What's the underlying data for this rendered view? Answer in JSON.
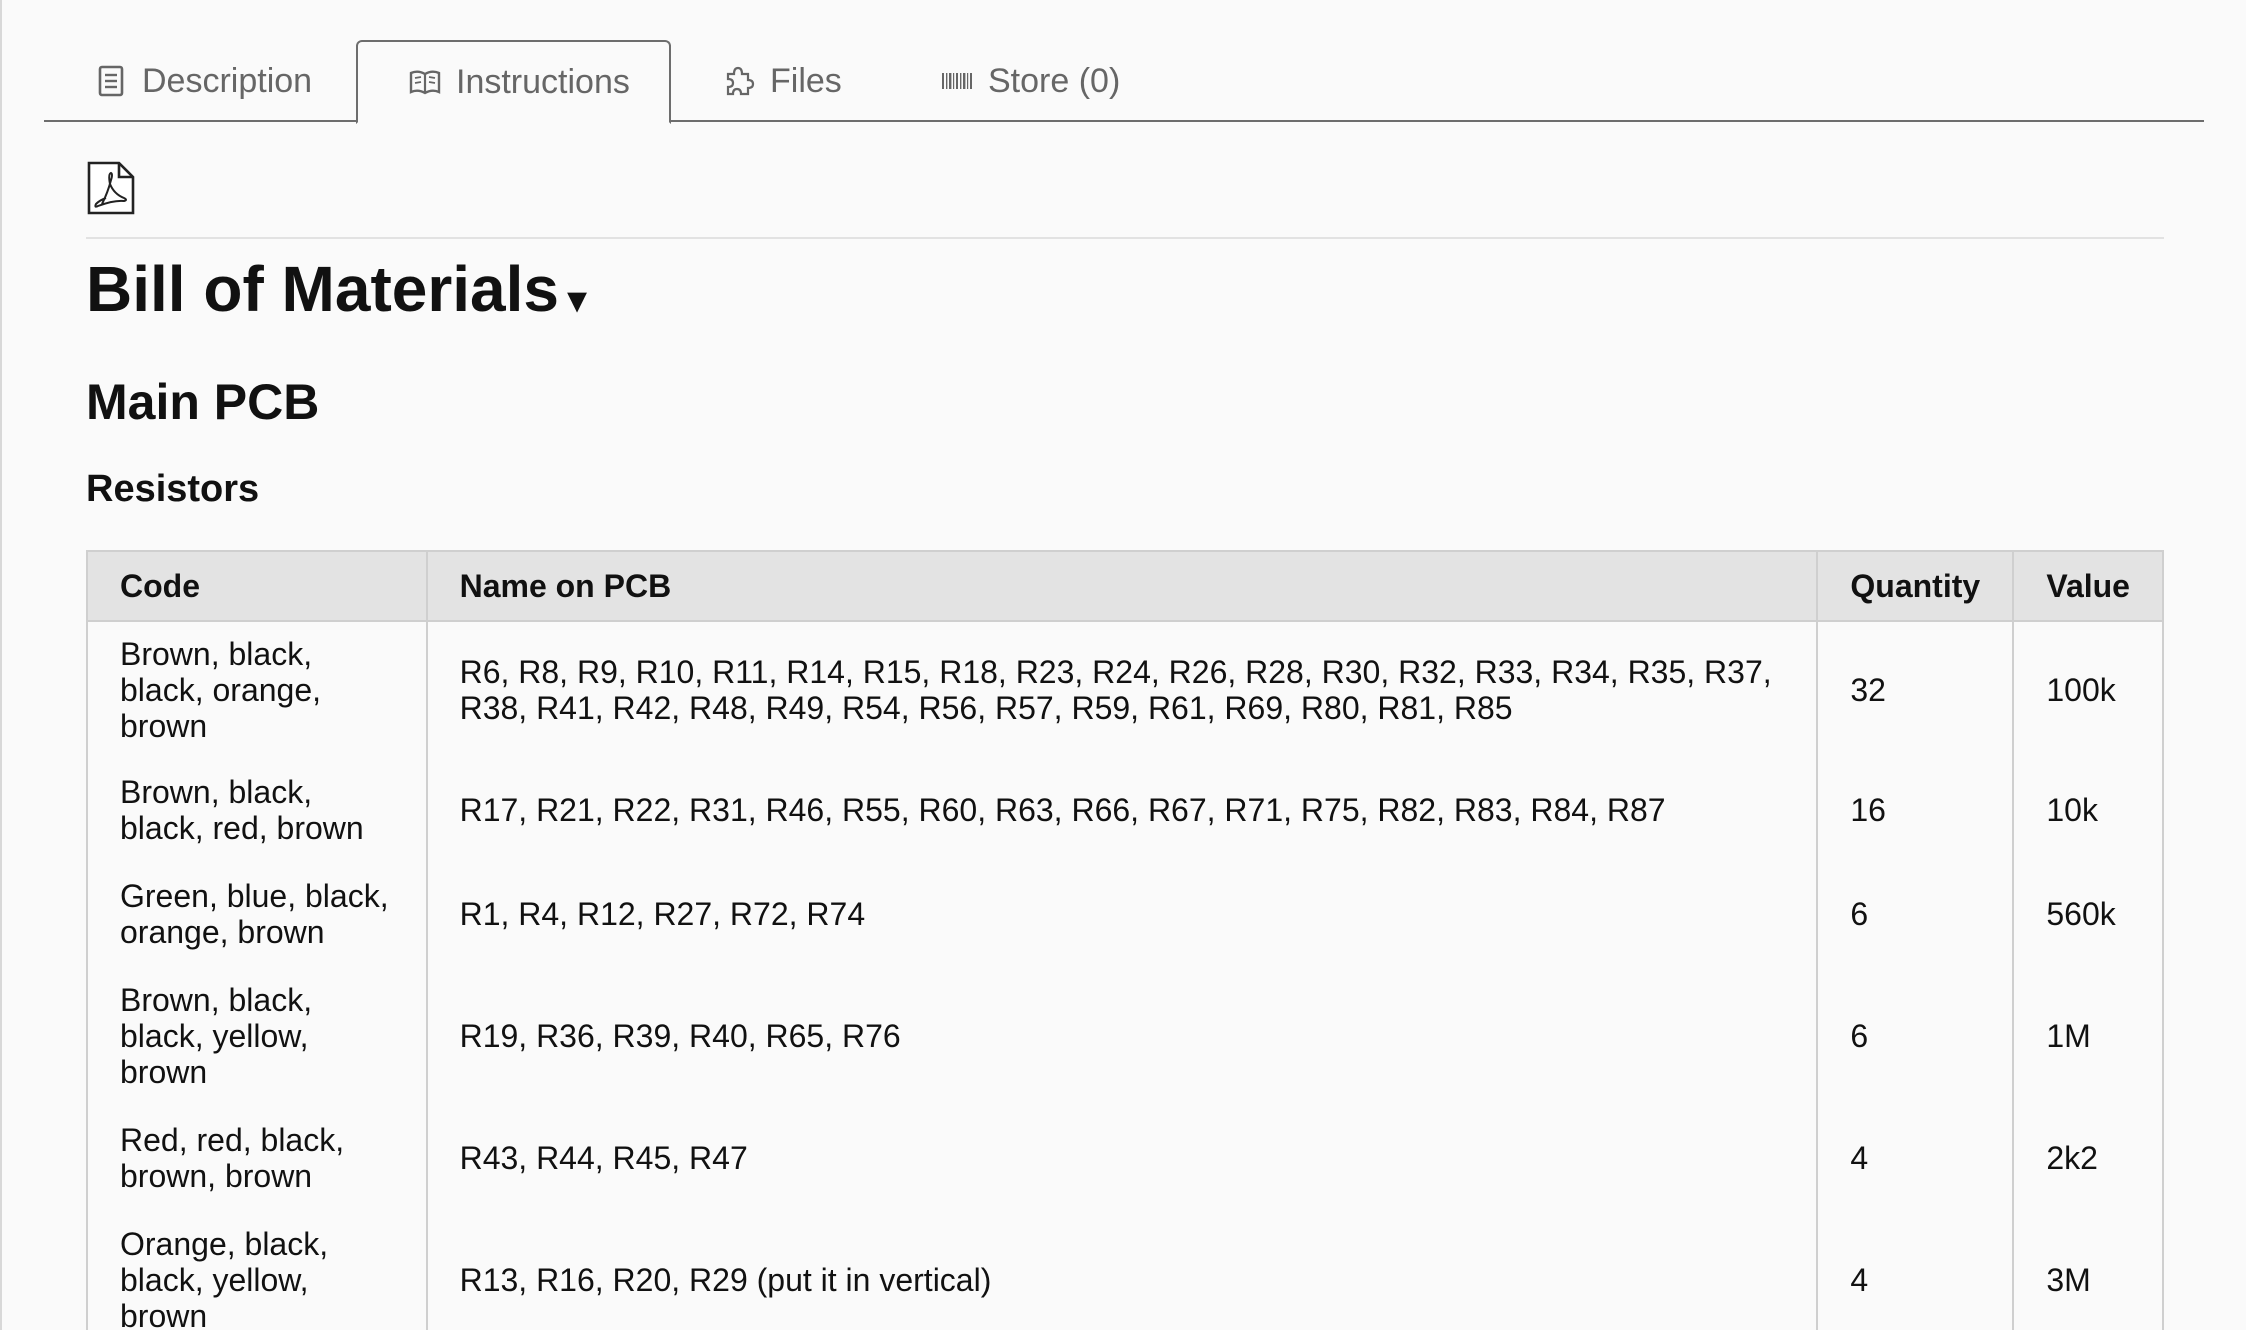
{
  "tabs": [
    {
      "label": "Description",
      "icon": "document-icon"
    },
    {
      "label": "Instructions",
      "icon": "book-icon"
    },
    {
      "label": "Files",
      "icon": "puzzle-icon"
    },
    {
      "label": "Store (0)",
      "icon": "barcode-icon"
    }
  ],
  "active_tab": "Instructions",
  "heading": {
    "title": "Bill of Materials",
    "caret": "▾",
    "subtitle": "Main PCB",
    "section": "Resistors"
  },
  "table": {
    "headers": [
      "Code",
      "Name on PCB",
      "Quantity",
      "Value"
    ],
    "rows": [
      {
        "code": "Brown, black, black, orange, brown",
        "name": "R6, R8, R9, R10, R11, R14, R15, R18, R23, R24, R26, R28, R30, R32, R33, R34, R35, R37, R38, R41, R42, R48, R49, R54, R56, R57, R59, R61, R69, R80, R81, R85",
        "quantity": "32",
        "value": "100k"
      },
      {
        "code": "Brown, black, black, red, brown",
        "name": "R17, R21, R22, R31, R46, R55, R60, R63, R66, R67, R71, R75, R82, R83, R84, R87",
        "quantity": "16",
        "value": "10k"
      },
      {
        "code": "Green, blue, black, orange, brown",
        "name": "R1, R4, R12, R27, R72, R74",
        "quantity": "6",
        "value": "560k"
      },
      {
        "code": "Brown, black, black, yellow, brown",
        "name": "R19, R36, R39, R40, R65, R76",
        "quantity": "6",
        "value": "1M"
      },
      {
        "code": "Red, red, black, brown, brown",
        "name": "R43, R44, R45, R47",
        "quantity": "4",
        "value": "2k2"
      },
      {
        "code": "Orange, black, black, yellow, brown",
        "name": "R13, R16, R20, R29 (put it in vertical)",
        "quantity": "4",
        "value": "3M"
      }
    ]
  },
  "colors": {
    "border": "#6d6d6d",
    "header_bg": "#e3e3e3",
    "tab_text": "#666666"
  }
}
